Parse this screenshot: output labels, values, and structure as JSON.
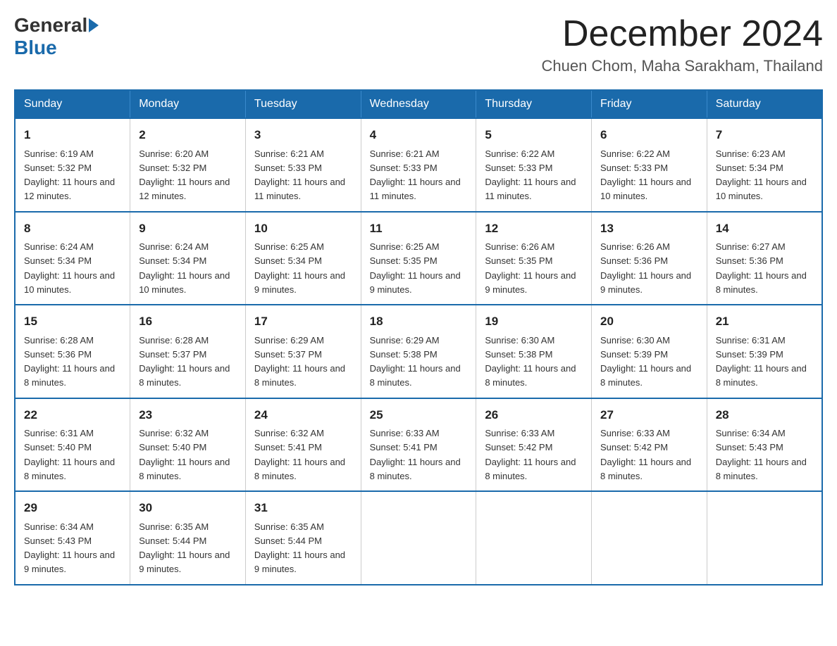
{
  "logo": {
    "general": "General",
    "arrow": "▶",
    "blue": "Blue"
  },
  "title": "December 2024",
  "location": "Chuen Chom, Maha Sarakham, Thailand",
  "days_of_week": [
    "Sunday",
    "Monday",
    "Tuesday",
    "Wednesday",
    "Thursday",
    "Friday",
    "Saturday"
  ],
  "weeks": [
    [
      {
        "day": "1",
        "sunrise": "6:19 AM",
        "sunset": "5:32 PM",
        "daylight": "11 hours and 12 minutes."
      },
      {
        "day": "2",
        "sunrise": "6:20 AM",
        "sunset": "5:32 PM",
        "daylight": "11 hours and 12 minutes."
      },
      {
        "day": "3",
        "sunrise": "6:21 AM",
        "sunset": "5:33 PM",
        "daylight": "11 hours and 11 minutes."
      },
      {
        "day": "4",
        "sunrise": "6:21 AM",
        "sunset": "5:33 PM",
        "daylight": "11 hours and 11 minutes."
      },
      {
        "day": "5",
        "sunrise": "6:22 AM",
        "sunset": "5:33 PM",
        "daylight": "11 hours and 11 minutes."
      },
      {
        "day": "6",
        "sunrise": "6:22 AM",
        "sunset": "5:33 PM",
        "daylight": "11 hours and 10 minutes."
      },
      {
        "day": "7",
        "sunrise": "6:23 AM",
        "sunset": "5:34 PM",
        "daylight": "11 hours and 10 minutes."
      }
    ],
    [
      {
        "day": "8",
        "sunrise": "6:24 AM",
        "sunset": "5:34 PM",
        "daylight": "11 hours and 10 minutes."
      },
      {
        "day": "9",
        "sunrise": "6:24 AM",
        "sunset": "5:34 PM",
        "daylight": "11 hours and 10 minutes."
      },
      {
        "day": "10",
        "sunrise": "6:25 AM",
        "sunset": "5:34 PM",
        "daylight": "11 hours and 9 minutes."
      },
      {
        "day": "11",
        "sunrise": "6:25 AM",
        "sunset": "5:35 PM",
        "daylight": "11 hours and 9 minutes."
      },
      {
        "day": "12",
        "sunrise": "6:26 AM",
        "sunset": "5:35 PM",
        "daylight": "11 hours and 9 minutes."
      },
      {
        "day": "13",
        "sunrise": "6:26 AM",
        "sunset": "5:36 PM",
        "daylight": "11 hours and 9 minutes."
      },
      {
        "day": "14",
        "sunrise": "6:27 AM",
        "sunset": "5:36 PM",
        "daylight": "11 hours and 8 minutes."
      }
    ],
    [
      {
        "day": "15",
        "sunrise": "6:28 AM",
        "sunset": "5:36 PM",
        "daylight": "11 hours and 8 minutes."
      },
      {
        "day": "16",
        "sunrise": "6:28 AM",
        "sunset": "5:37 PM",
        "daylight": "11 hours and 8 minutes."
      },
      {
        "day": "17",
        "sunrise": "6:29 AM",
        "sunset": "5:37 PM",
        "daylight": "11 hours and 8 minutes."
      },
      {
        "day": "18",
        "sunrise": "6:29 AM",
        "sunset": "5:38 PM",
        "daylight": "11 hours and 8 minutes."
      },
      {
        "day": "19",
        "sunrise": "6:30 AM",
        "sunset": "5:38 PM",
        "daylight": "11 hours and 8 minutes."
      },
      {
        "day": "20",
        "sunrise": "6:30 AM",
        "sunset": "5:39 PM",
        "daylight": "11 hours and 8 minutes."
      },
      {
        "day": "21",
        "sunrise": "6:31 AM",
        "sunset": "5:39 PM",
        "daylight": "11 hours and 8 minutes."
      }
    ],
    [
      {
        "day": "22",
        "sunrise": "6:31 AM",
        "sunset": "5:40 PM",
        "daylight": "11 hours and 8 minutes."
      },
      {
        "day": "23",
        "sunrise": "6:32 AM",
        "sunset": "5:40 PM",
        "daylight": "11 hours and 8 minutes."
      },
      {
        "day": "24",
        "sunrise": "6:32 AM",
        "sunset": "5:41 PM",
        "daylight": "11 hours and 8 minutes."
      },
      {
        "day": "25",
        "sunrise": "6:33 AM",
        "sunset": "5:41 PM",
        "daylight": "11 hours and 8 minutes."
      },
      {
        "day": "26",
        "sunrise": "6:33 AM",
        "sunset": "5:42 PM",
        "daylight": "11 hours and 8 minutes."
      },
      {
        "day": "27",
        "sunrise": "6:33 AM",
        "sunset": "5:42 PM",
        "daylight": "11 hours and 8 minutes."
      },
      {
        "day": "28",
        "sunrise": "6:34 AM",
        "sunset": "5:43 PM",
        "daylight": "11 hours and 8 minutes."
      }
    ],
    [
      {
        "day": "29",
        "sunrise": "6:34 AM",
        "sunset": "5:43 PM",
        "daylight": "11 hours and 9 minutes."
      },
      {
        "day": "30",
        "sunrise": "6:35 AM",
        "sunset": "5:44 PM",
        "daylight": "11 hours and 9 minutes."
      },
      {
        "day": "31",
        "sunrise": "6:35 AM",
        "sunset": "5:44 PM",
        "daylight": "11 hours and 9 minutes."
      },
      null,
      null,
      null,
      null
    ]
  ]
}
